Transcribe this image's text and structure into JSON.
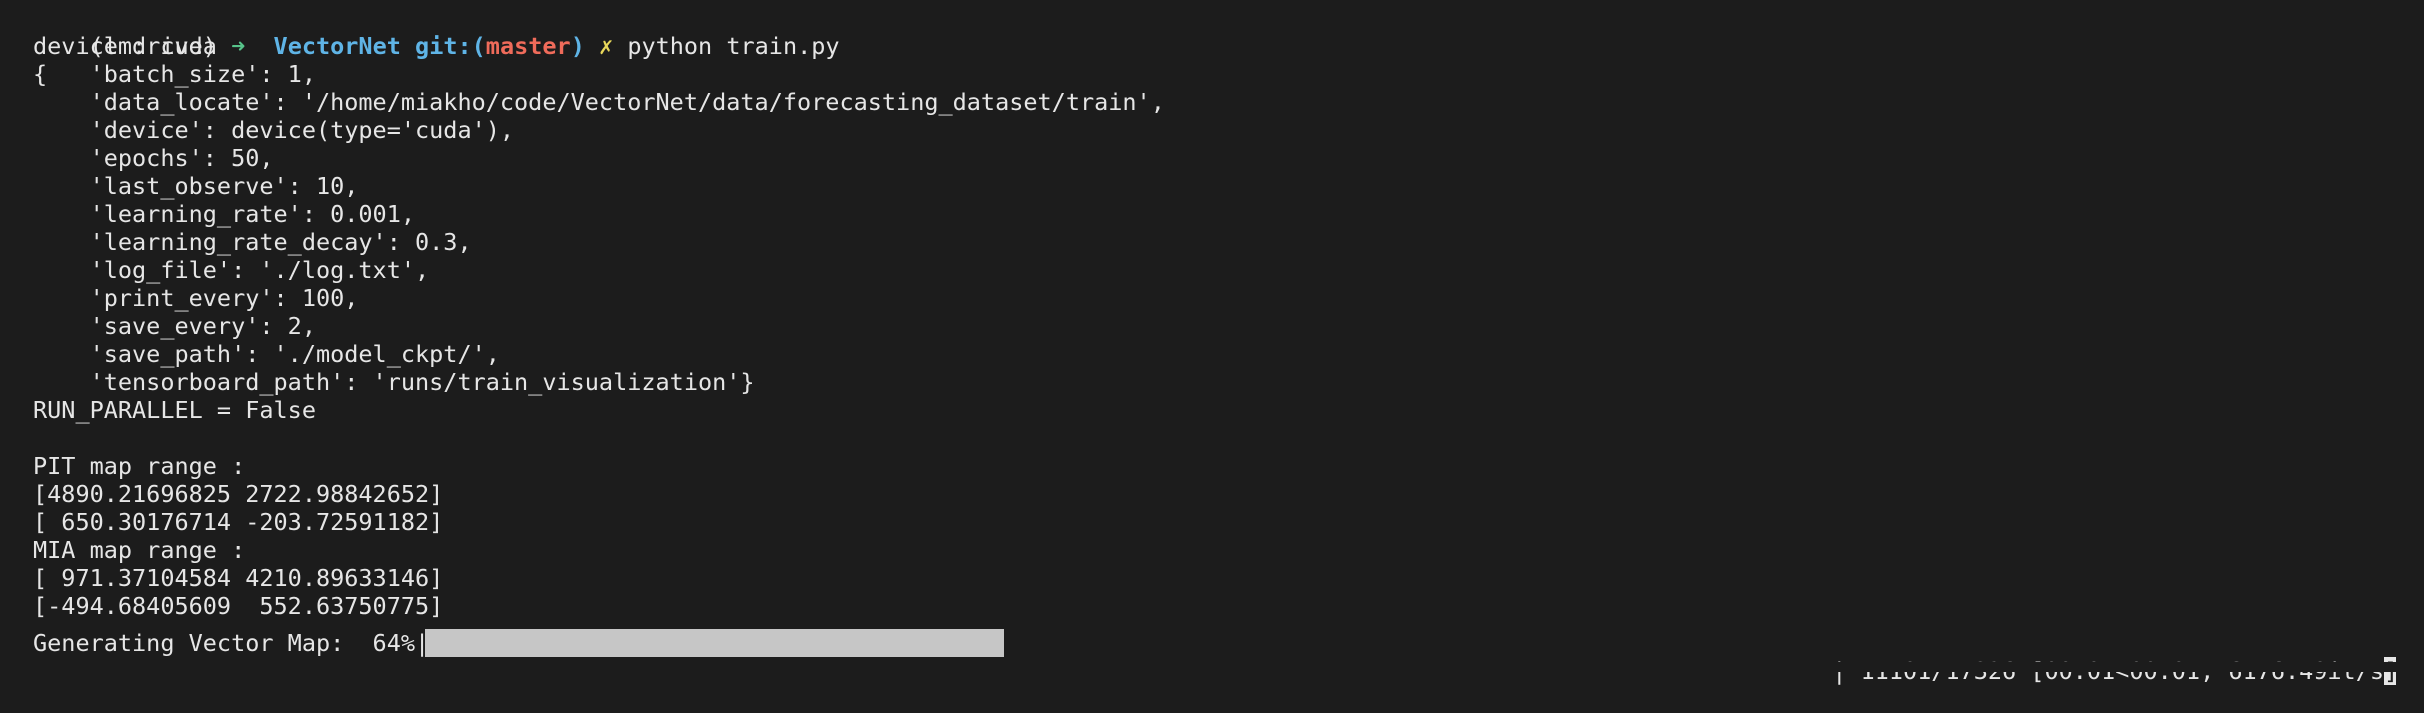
{
  "prompt": {
    "env": "(lmdrive)",
    "arrow": "➜",
    "repo": "VectorNet",
    "git_label": "git:(",
    "branch": "master",
    "git_close": ")",
    "dirty_mark": "✗",
    "command": "python train.py"
  },
  "output_lines": [
    "device : cuda",
    "{   'batch_size': 1,",
    "    'data_locate': '/home/miakho/code/VectorNet/data/forecasting_dataset/train',",
    "    'device': device(type='cuda'),",
    "    'epochs': 50,",
    "    'last_observe': 10,",
    "    'learning_rate': 0.001,",
    "    'learning_rate_decay': 0.3,",
    "    'log_file': './log.txt',",
    "    'print_every': 100,",
    "    'save_every': 2,",
    "    'save_path': './model_ckpt/',",
    "    'tensorboard_path': 'runs/train_visualization'}",
    "RUN_PARALLEL = False",
    "",
    "PIT map range :",
    "[4890.21696825 2722.98842652]",
    "[ 650.30176714 -203.72591182]",
    "MIA map range :",
    "[ 971.37104584 4210.89633146]",
    "[-494.68405609  552.63750775]"
  ],
  "progress": {
    "label": "Generating Vector Map:  64%|",
    "fraction": 0.64,
    "stats": "| 11101/17326 [00:01<00:01, 6176.49it/s",
    "cursor_char": "]"
  },
  "colors": {
    "background": "#1c1c1c",
    "text": "#e6e6e6",
    "arrow": "#57c38a",
    "repo": "#5fb4e6",
    "branch": "#ef6b5a",
    "dirty": "#e8d75a",
    "progress_fill": "#c6c6c6"
  }
}
